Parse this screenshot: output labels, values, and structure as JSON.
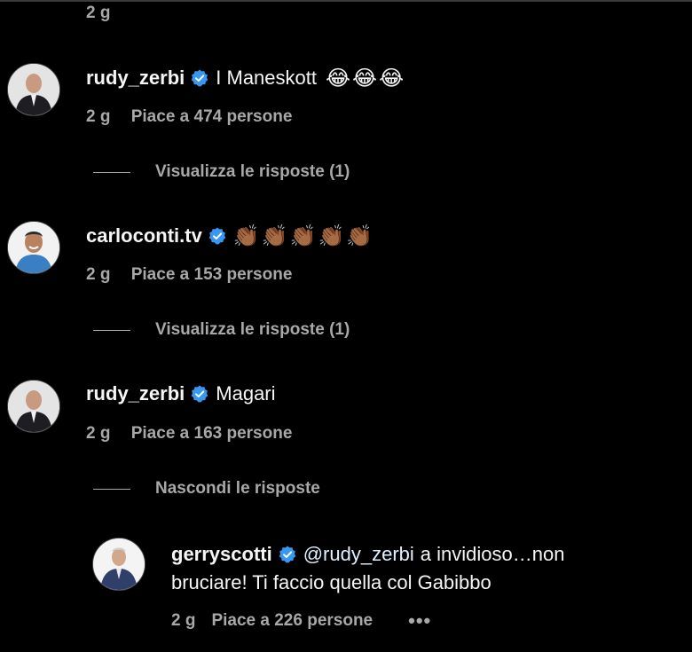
{
  "top_meta": {
    "time": "2 g"
  },
  "comments": [
    {
      "username": "rudy_zerbi",
      "text": "I Maneskott",
      "emoji": "😂😂😂",
      "time": "2 g",
      "likes": "Piace a 474 persone",
      "replies_toggle": "Visualizza le risposte (1)"
    },
    {
      "username": "carloconti.tv",
      "text": "",
      "emoji": "👏🏾👏🏾👏🏾👏🏾👏🏾",
      "time": "2 g",
      "likes": "Piace a 153 persone",
      "replies_toggle": "Visualizza le risposte (1)"
    },
    {
      "username": "rudy_zerbi",
      "text": "Magari",
      "emoji": "",
      "time": "2 g",
      "likes": "Piace a 163 persone",
      "replies_toggle": "Nascondi le risposte"
    }
  ],
  "reply": {
    "username": "gerryscotti",
    "mention": "@rudy_zerbi",
    "text_line1": "a invidioso…non",
    "text_line2": "bruciare! Ti faccio quella col Gabibbo",
    "time": "2 g",
    "likes": "Piace a 226 persone",
    "more": "•••"
  },
  "colors": {
    "background": "#000000",
    "text": "#f5f5f5",
    "secondary": "#a8a8a8",
    "verified": "#3897f0"
  },
  "icons": {
    "verified": "verified-badge-icon",
    "more": "more-options-icon"
  }
}
